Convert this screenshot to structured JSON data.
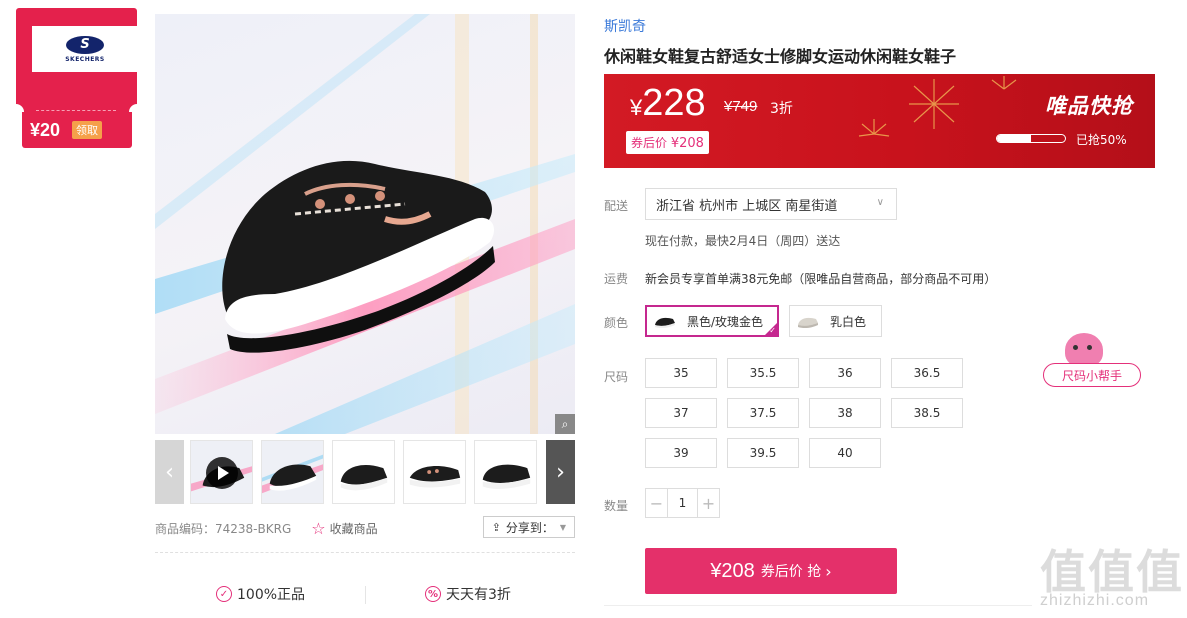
{
  "coupon": {
    "amount": "¥20",
    "claim_label": "领取",
    "logo_brand": "SKECHERS",
    "logo_mark": "S"
  },
  "gallery": {
    "thumbnails": [
      {
        "kind": "video"
      },
      {
        "kind": "image"
      },
      {
        "kind": "image"
      },
      {
        "kind": "image"
      },
      {
        "kind": "image"
      }
    ],
    "prev_icon": "‹",
    "next_icon": "›",
    "zoom_icon": "magnifier-icon"
  },
  "meta": {
    "product_code": "商品编码：74238-BKRG",
    "favorite_label": "收藏商品",
    "share_label": "分享到："
  },
  "assurances": [
    {
      "label": "100%正品",
      "icon": "shield-check-icon"
    },
    {
      "label": "天天有3折",
      "icon": "percent-badge-icon"
    }
  ],
  "product": {
    "brand": "斯凯奇",
    "title": "休闲鞋女鞋复古舒适女士修脚女运动休闲鞋女鞋子"
  },
  "price": {
    "yen": "¥",
    "current": "228",
    "original": "¥749",
    "discount": "3折",
    "after_coupon_label": "券后价",
    "after_coupon_value": "¥208",
    "flash_title": "唯品快抢",
    "sold_percent": 50,
    "sold_text": "已抢50%",
    "banner_color": "#d31a24"
  },
  "delivery": {
    "label": "配送",
    "address": "浙江省 杭州市 上城区 南星街道",
    "note": "现在付款，最快2月4日（周四）送达"
  },
  "shipping": {
    "label": "运费",
    "text": "新会员专享首单满38元免邮（限唯品自营商品，部分商品不可用）"
  },
  "colors": {
    "label": "颜色",
    "options": [
      {
        "name": "黑色/玫瑰金色",
        "selected": true
      },
      {
        "name": "乳白色",
        "selected": false
      }
    ],
    "selected_color": "#c5288f"
  },
  "sizes": {
    "label": "尺码",
    "options": [
      "35",
      "35.5",
      "36",
      "36.5",
      "37",
      "37.5",
      "38",
      "38.5",
      "39",
      "39.5",
      "40"
    ],
    "helper_label": "尺码小帮手"
  },
  "quantity": {
    "label": "数量",
    "value": "1",
    "minus": "−",
    "plus": "+"
  },
  "buy": {
    "price": "¥208",
    "label": "券后价 抢",
    "arrow": "›",
    "color": "#e4306a"
  },
  "watermark": {
    "glyphs": "值值值",
    "url": "zhizhizhi.com"
  }
}
